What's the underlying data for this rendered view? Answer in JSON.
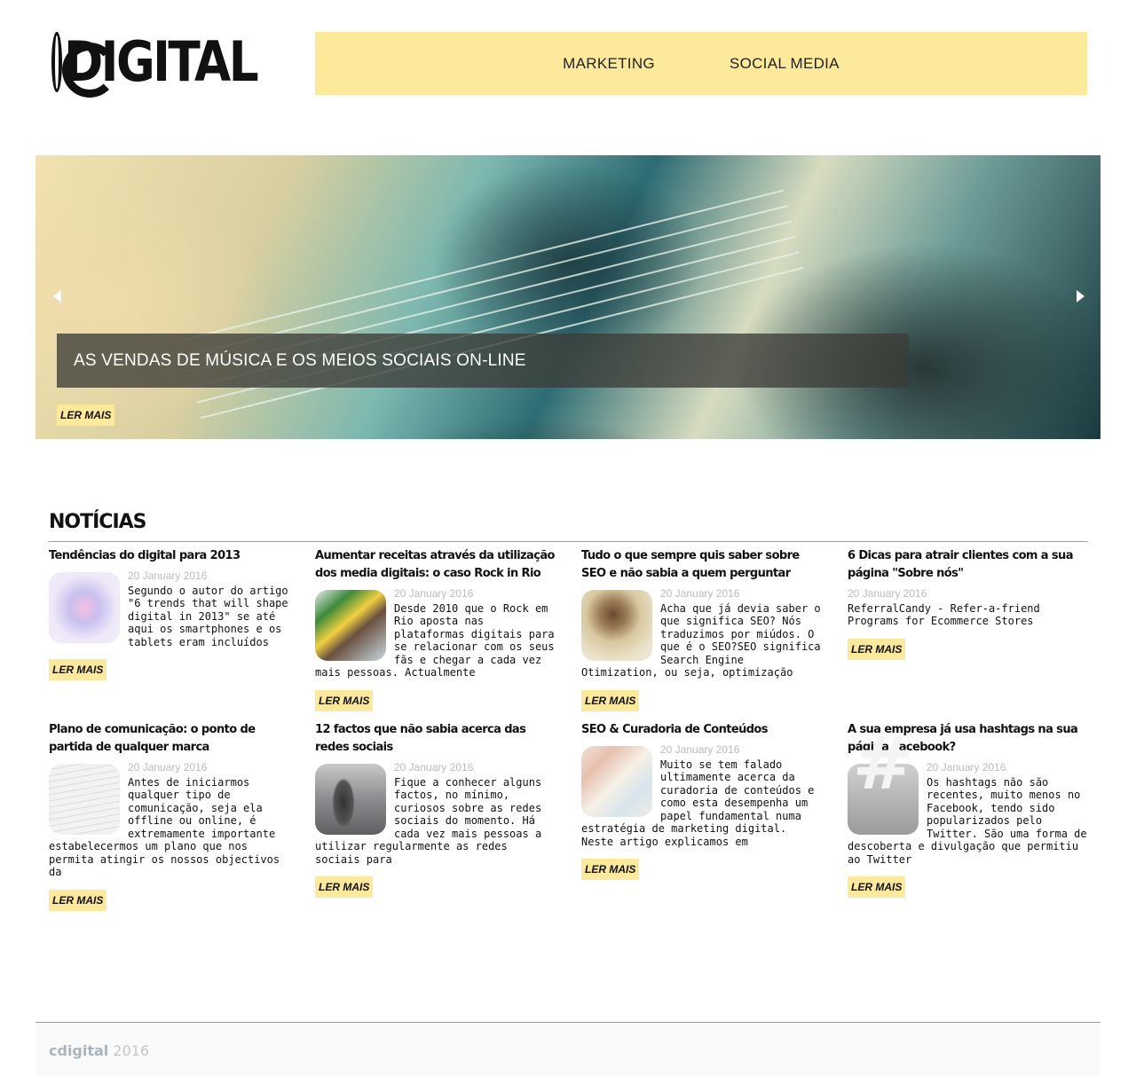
{
  "brand": {
    "logo_text": "DIGITAL"
  },
  "nav": {
    "items": [
      "MARKETING",
      "SOCIAL MEDIA"
    ]
  },
  "hero": {
    "caption": "AS VENDAS DE MÚSICA E OS MEIOS SOCIAIS ON-LINE",
    "button": "LER MAIS"
  },
  "news": {
    "heading": "NOTÍCIAS",
    "articles": [
      {
        "title": "Tendências do digital para 2013",
        "date": "20 January 2016",
        "excerpt": "Segundo o autor do artigo \"6 trends that will shape digital in 2013\"  se até aqui os smartphones e os tablets eram incluídos",
        "button": "LER MAIS"
      },
      {
        "title": "Aumentar receitas através da utilização dos media digitais: o caso Rock in Rio",
        "date": "20 January 2016",
        "excerpt": "Desde 2010 que o Rock em Rio aposta nas plataformas digitais para se relacionar com os seus fãs e chegar a cada vez mais pessoas. Actualmente",
        "button": "LER MAIS"
      },
      {
        "title": "Tudo o que sempre quis saber sobre SEO e não sabia a quem perguntar",
        "date": "20 January 2016",
        "excerpt": "Acha que já devia saber o que significa SEO? Nós traduzimos por miúdos. O que é o SEO?SEO significa Search Engine Otimization, ou seja, optimização",
        "button": "LER MAIS"
      },
      {
        "title": "6 Dicas para atrair clientes com a sua página \"Sobre nós\"",
        "date": "20 January 2016",
        "excerpt": "ReferralCandy - Refer-a-friend Programs for Ecommerce Stores",
        "button": "LER MAIS"
      },
      {
        "title": "Plano de comunicação: o ponto de partida de qualquer marca",
        "date": "20 January 2016",
        "excerpt": "Antes de iniciarmos qualquer tipo de comunicação, seja ela offline ou online, é extremamente importante estabelecermos um plano que nos permita atingir os nossos objectivos da",
        "button": "LER MAIS"
      },
      {
        "title": "12 factos que não sabia acerca das redes sociais",
        "date": "20 January 2016",
        "excerpt": "Fique a conhecer alguns factos, no mínimo, curiosos sobre as redes sociais do momento. Há cada vez mais pessoas a utilizar regularmente as redes sociais para",
        "button": "LER MAIS"
      },
      {
        "title": "SEO & Curadoria de Conteúdos",
        "date": "20 January 2016",
        "excerpt": "Muito se tem falado ultimamente acerca da curadoria de conteúdos e como esta desempenha um papel fundamental numa estratégia de marketing digital. Neste artigo explicamos em",
        "button": "LER MAIS"
      },
      {
        "title": "A sua empresa já usa hashtags na sua página Facebook?",
        "date": "20 January 2016",
        "excerpt": "Os hashtags não são recentes, muito menos no Facebook, tendo sido popularizados pelo Twitter. São uma forma de descoberta e divulgação que permitiu ao Twitter",
        "button": "LER MAIS"
      }
    ]
  },
  "footer": {
    "brand": "cdigital",
    "year": "2016"
  }
}
